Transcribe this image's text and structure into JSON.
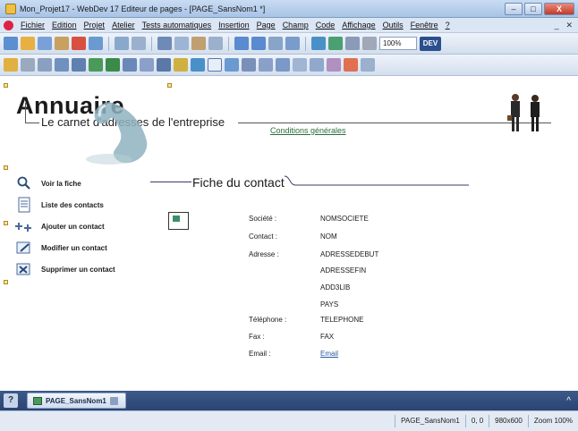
{
  "window": {
    "title": "Mon_Projet17 - WebDev 17  Editeur de pages - [PAGE_SansNom1 *]",
    "controls": {
      "minimize": "–",
      "maximize": "□",
      "close": "X"
    }
  },
  "menubar": {
    "items": [
      "Fichier",
      "Edition",
      "Projet",
      "Atelier",
      "Tests automatiques",
      "Insertion",
      "Page",
      "Champ",
      "Code",
      "Affichage",
      "Outils",
      "Fenêtre",
      "?"
    ],
    "right": [
      "_",
      " ✕"
    ]
  },
  "toolbar": {
    "zoom": "100%",
    "dev_badge": "DEV"
  },
  "page": {
    "logo_title": "Annuaire",
    "logo_subtitle": "Le carnet d'adresses de l'entreprise",
    "conditions_link": "Conditions générales",
    "nav": [
      {
        "label": "Voir la fiche",
        "icon": "magnifier-icon"
      },
      {
        "label": "Liste des contacts",
        "icon": "document-list-icon"
      },
      {
        "label": "Ajouter un contact",
        "icon": "add-contact-icon"
      },
      {
        "label": "Modifier un contact",
        "icon": "edit-contact-icon"
      },
      {
        "label": "Supprimer un contact",
        "icon": "delete-contact-icon"
      }
    ],
    "section_title": "Fiche du contact",
    "fields": [
      {
        "label": "Société :",
        "value": "NOMSOCIETE"
      },
      {
        "label": "Contact :",
        "value": "NOM"
      },
      {
        "label": "Adresse :",
        "value": "ADRESSEDEBUT"
      },
      {
        "label": "",
        "value": "ADRESSEFIN"
      },
      {
        "label": "",
        "value": "ADD3LIB"
      },
      {
        "label": "",
        "value": "PAYS"
      },
      {
        "label": "Téléphone :",
        "value": "TELEPHONE"
      },
      {
        "label": "Fax :",
        "value": "FAX"
      },
      {
        "label": "Email :",
        "value": "Email",
        "link": true
      }
    ]
  },
  "bottom": {
    "help": "?",
    "tab_label": "PAGE_SansNom1",
    "collapse": "^"
  },
  "status": {
    "page": "PAGE_SansNom1",
    "coords": "0, 0",
    "size": "980x600",
    "zoom": "Zoom 100%"
  }
}
